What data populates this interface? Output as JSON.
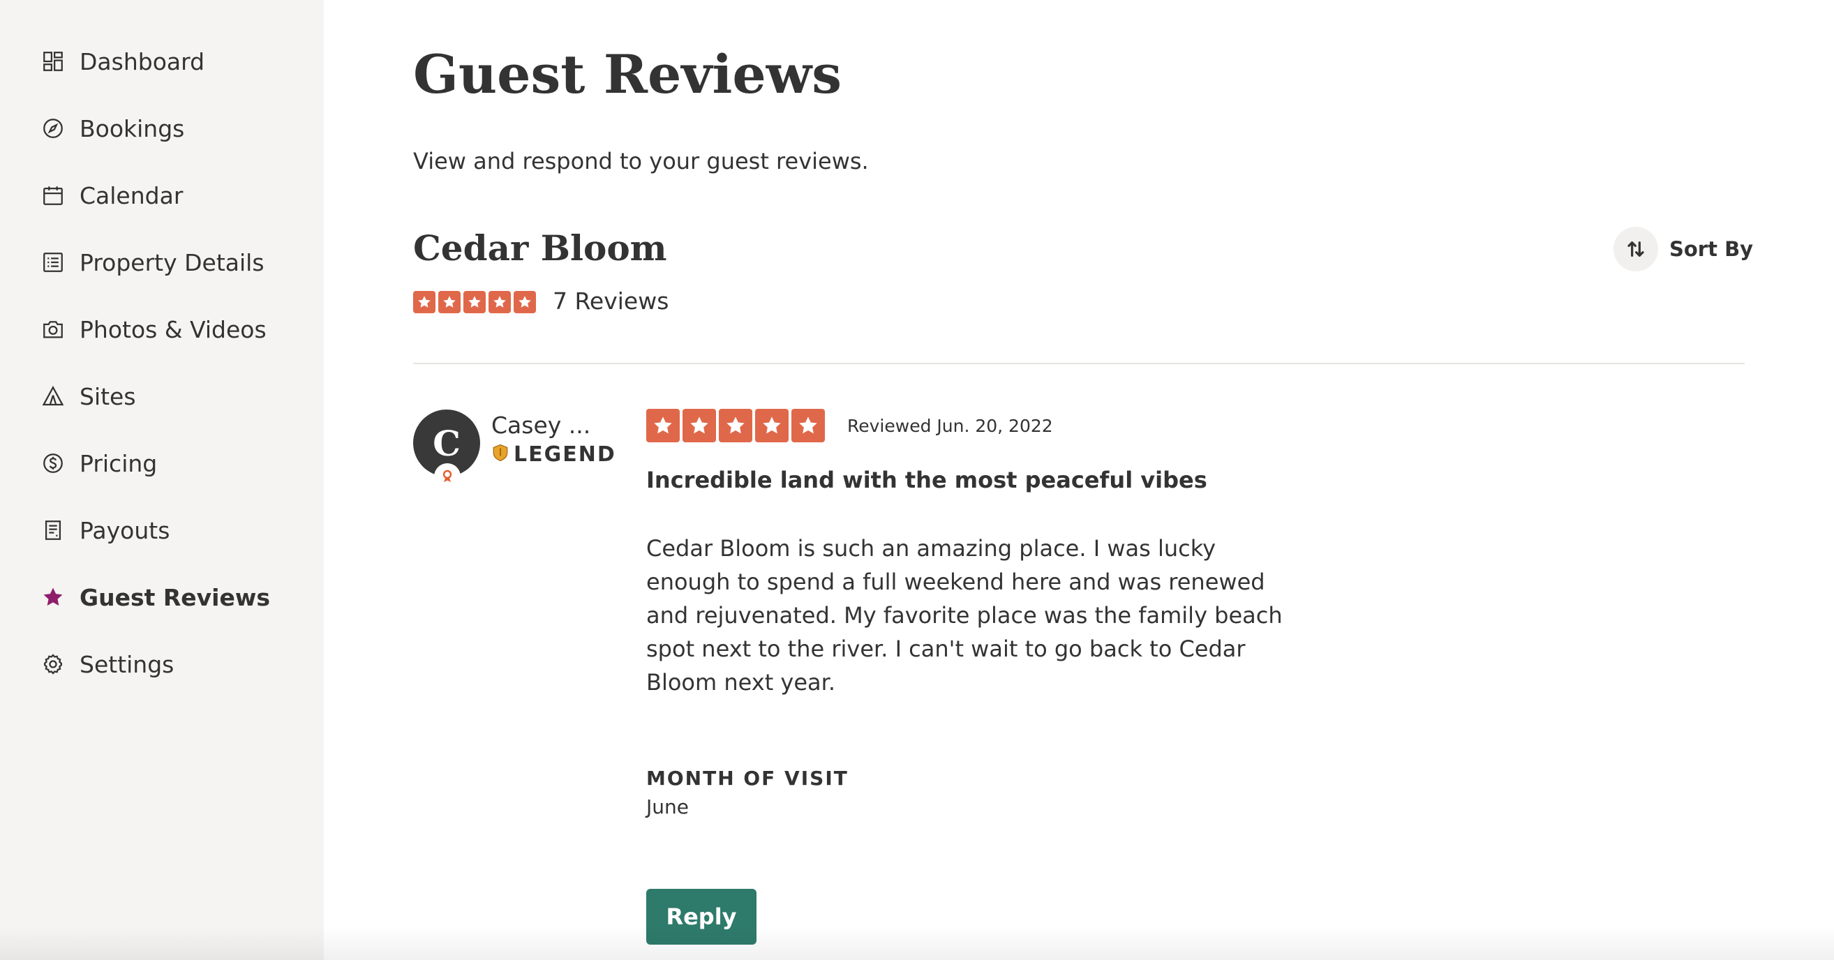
{
  "sidebar": {
    "items": [
      {
        "label": "Dashboard",
        "icon": "dashboard-icon"
      },
      {
        "label": "Bookings",
        "icon": "compass-icon"
      },
      {
        "label": "Calendar",
        "icon": "calendar-icon"
      },
      {
        "label": "Property Details",
        "icon": "list-icon"
      },
      {
        "label": "Photos & Videos",
        "icon": "camera-icon"
      },
      {
        "label": "Sites",
        "icon": "tent-icon"
      },
      {
        "label": "Pricing",
        "icon": "dollar-icon"
      },
      {
        "label": "Payouts",
        "icon": "receipt-icon"
      },
      {
        "label": "Guest Reviews",
        "icon": "star-icon",
        "active": true
      },
      {
        "label": "Settings",
        "icon": "gear-icon"
      }
    ]
  },
  "header": {
    "title": "Guest Reviews",
    "subtitle": "View and respond to your guest reviews."
  },
  "property": {
    "name": "Cedar Bloom",
    "rating": 5,
    "review_count_label": "7 Reviews",
    "sort_label": "Sort By"
  },
  "review": {
    "avatar_initial": "C",
    "reviewer_name": "Casey ...",
    "badge_label": "LEGEND",
    "rating": 5,
    "date_label": "Reviewed Jun. 20, 2022",
    "title": "Incredible land with the most peaceful vibes",
    "body": "Cedar Bloom is such an amazing place. I was lucky enough to spend a full weekend here and was renewed and rejuvenated. My favorite place was the family beach spot next to the river. I can't wait to go back to Cedar Bloom next year.",
    "visit_label": "MONTH OF VISIT",
    "visit_value": "June",
    "reply_label": "Reply"
  },
  "colors": {
    "star": "#e0684a",
    "active_nav": "#8e1e6b",
    "reply_button": "#2e7a6b",
    "sidebar_bg": "#f5f4f2",
    "avatar_bg": "#393939",
    "badge_gold": "#e8a32b",
    "badge_orange": "#e35d2b"
  }
}
